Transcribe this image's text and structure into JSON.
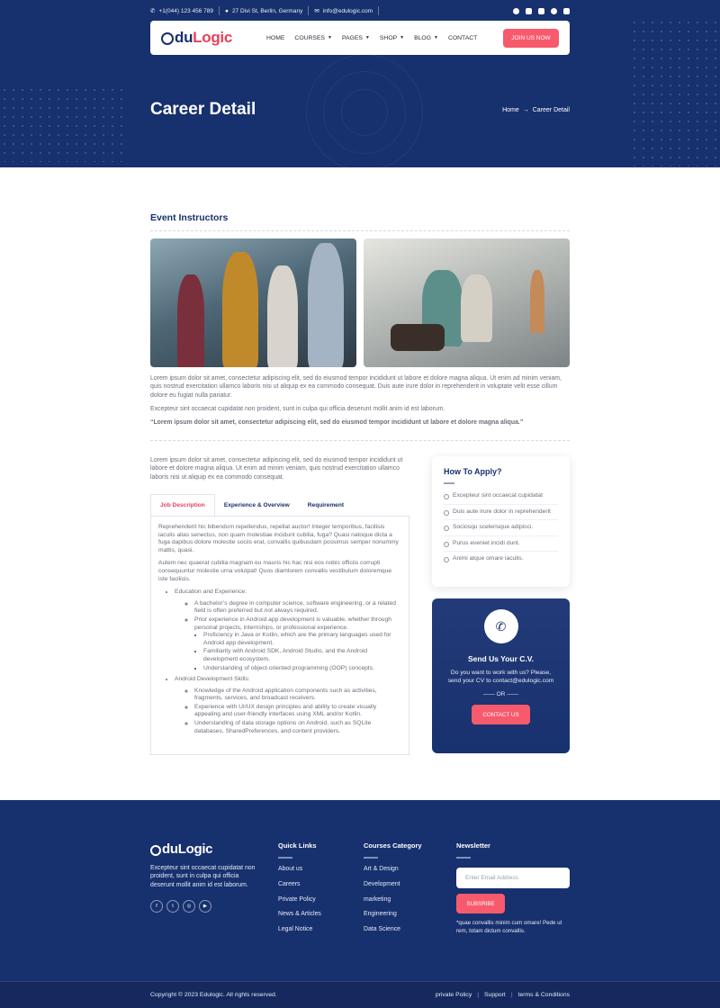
{
  "topbar": {
    "phone": "+1(044) 123 456 789",
    "address": "27 Divi St, Berlin, Germany",
    "email": "info@edulogic.com"
  },
  "brand": {
    "logo_main": "du",
    "logo_accent": "Logic",
    "footer_logo": "duLogic"
  },
  "nav": {
    "items": [
      "HOME",
      "COURSES",
      "PAGES",
      "SHOP",
      "BLOG",
      "CONTACT"
    ],
    "join": "JOIN US NOW"
  },
  "hero": {
    "title": "Career Detail",
    "crumb_home": "Home",
    "crumb_arrow": "→",
    "crumb_current": "Career Detail"
  },
  "main": {
    "section_title": "Event Instructors",
    "para1": "Lorem ipsum dolor sit amet, consectetur adipiscing elit, sed do eiusmod tempor incididunt ut labore et dolore magna aliqua. Ut enim ad minim veniam, quis nostrud exercitation ullamco laboris nisi ut aliquip ex ea commodo consequat. Duis aute irure dolor in reprehenderit in voluptate velit esse cillum dolore eu fugiat nulla pariatur.",
    "para2": "Excepteur sint occaecat cupidatat non proident, sunt in culpa qui officia deserunt mollit anim id est laborum.",
    "quote": "“Lorem ipsum dolor sit amet, consectetur adipiscing elit, sed do eiusmod tempor incididunt ut labore et dolore magna aliqua.”",
    "para3": "Lorem ipsum dolor sit amet, consectetur adipiscing elit, sed do eiusmod tempor incididunt ut labore et dolore magna aliqua. Ut enim ad minim veniam, quis nostrud exercitation ullamco laboris nisi ut aliquip ex ea commodo consequat."
  },
  "tabs": {
    "labels": [
      "Job Description",
      "Experience & Overview",
      "Requirement"
    ],
    "p1": "Reprehenderit hic bibendum repellendus, repellat auctor! Integer temporibus, facilisis iaculis alias senectus, non quam molestiae incidunt cubilia, fuga? Quasi natoque dicta a fuga dapibus dolore molestie sociis erat, convallis quibusdam possimus semper nonummy mattis, quasi.",
    "p2": "Autem nec quaerat cubilia magnam eu mauris hic hac nisi eos nobis officiis corrupti consequuntur molestie urna volutpat! Quos diamlorem convallis vestibulum doloremque iste facilisis.",
    "edu": "Education and Experience:",
    "edu1": "A bachelor’s degree in computer science, software engineering, or a related field is often preferred but not always required.",
    "edu2": "Prior experience in Android app development is valuable, whether through personal projects, internships, or professional experience.",
    "edu2a": "Proficiency in Java or Kotlin, which are the primary languages used for Android app development.",
    "edu2b": "Familiarity with Android SDK, Android Studio, and the Android development ecosystem.",
    "edu2c": "Understanding of object-oriented programming (OOP) concepts.",
    "skills": "Android Development Skills:",
    "sk1": "Knowledge of the Android application components such as activities, fragments, services, and broadcast receivers.",
    "sk2": "Experience with UI/UX design principles and ability to create visually appealing and user-friendly interfaces using XML and/or Kotlin.",
    "sk3": "Understanding of data storage options on Android, such as SQLite databases, SharedPreferences, and content providers."
  },
  "apply": {
    "title": "How To Apply?",
    "items": [
      "Excepteur sint occaecat cupidatat",
      "Duis aute irure dolor in reprehenderit",
      "Sociosqu scelerisque adipisci.",
      "Purus eveniet incidi dunt.",
      "Animi atque omare iaculis."
    ]
  },
  "cv": {
    "title": "Send Us Your C.V.",
    "text": "Do you want to work with us? Please, send your CV to contact@edulogic.com",
    "or": "OR",
    "button": "CONTACT US"
  },
  "footer": {
    "about": "Excepteur sint occaecat cupidatat non proident, sunt in culpa qui officia deserunt mollit anim id est laborum.",
    "quick_title": "Quick Links",
    "quick": [
      "About us",
      "Careers",
      "Private Policy",
      "News & Articles",
      "Legal Notice"
    ],
    "cat_title": "Courses Category",
    "cats": [
      "Art & Design",
      "Development",
      "marketing",
      "Engineering",
      "Data Science"
    ],
    "news_title": "Newsletter",
    "email_placeholder": "Enter Email Address",
    "subscribe": "SUBSRIBE",
    "note": "*quae convallis minim cum omare! Pede ut rem, totam dictum convallis.",
    "copyright": "Copyright © 2023 Edulogic. All rights reserved.",
    "bottom_links": [
      "private Policy",
      "Support",
      "terms & Conditions"
    ]
  },
  "colors": {
    "navy": "#17306e",
    "accent": "#f85a6d"
  }
}
